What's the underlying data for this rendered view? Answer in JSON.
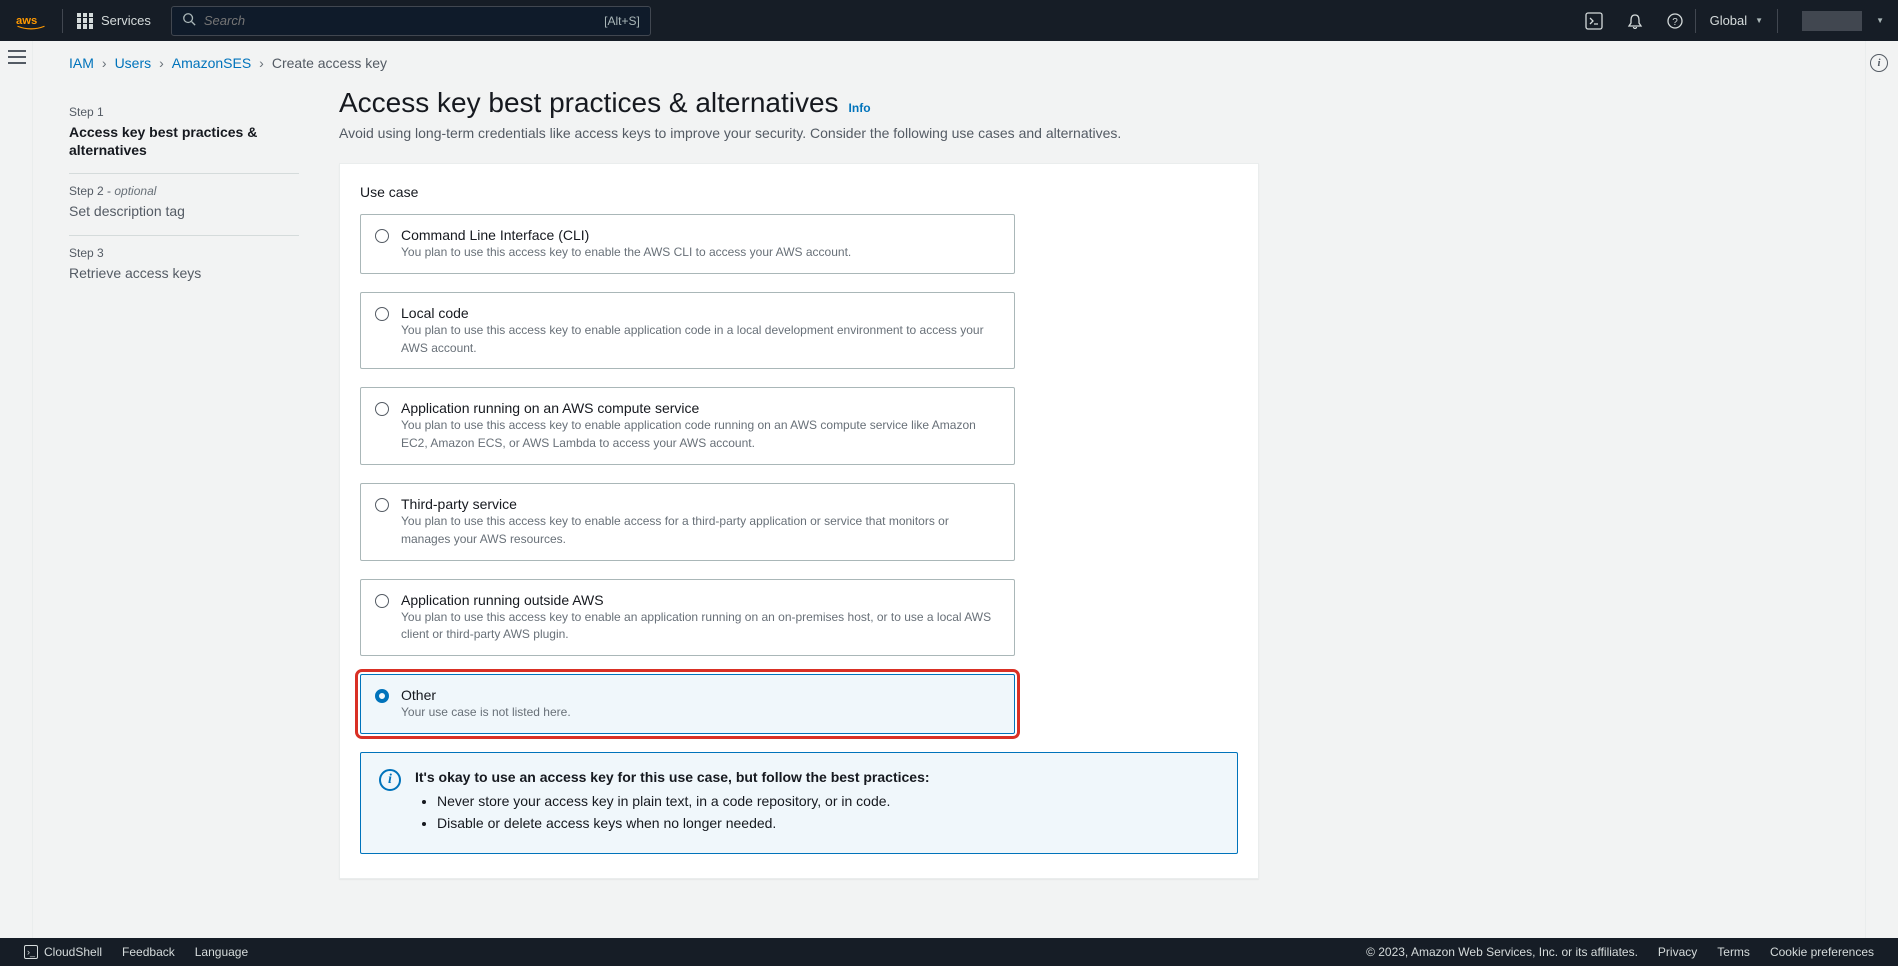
{
  "topnav": {
    "services": "Services",
    "search_placeholder": "Search",
    "search_shortcut": "[Alt+S]",
    "region": "Global"
  },
  "breadcrumbs": {
    "items": [
      "IAM",
      "Users",
      "AmazonSES"
    ],
    "current": "Create access key"
  },
  "steps": [
    {
      "num": "Step 1",
      "optional": "",
      "title": "Access key best practices & alternatives",
      "active": true
    },
    {
      "num": "Step 2",
      "optional": "optional",
      "title": "Set description tag",
      "active": false
    },
    {
      "num": "Step 3",
      "optional": "",
      "title": "Retrieve access keys",
      "active": false
    }
  ],
  "page": {
    "title": "Access key best practices & alternatives",
    "info": "Info",
    "desc": "Avoid using long-term credentials like access keys to improve your security. Consider the following use cases and alternatives."
  },
  "panel": {
    "heading": "Use case",
    "options": [
      {
        "title": "Command Line Interface (CLI)",
        "desc": "You plan to use this access key to enable the AWS CLI to access your AWS account.",
        "selected": false
      },
      {
        "title": "Local code",
        "desc": "You plan to use this access key to enable application code in a local development environment to access your AWS account.",
        "selected": false
      },
      {
        "title": "Application running on an AWS compute service",
        "desc": "You plan to use this access key to enable application code running on an AWS compute service like Amazon EC2, Amazon ECS, or AWS Lambda to access your AWS account.",
        "selected": false
      },
      {
        "title": "Third-party service",
        "desc": "You plan to use this access key to enable access for a third-party application or service that monitors or manages your AWS resources.",
        "selected": false
      },
      {
        "title": "Application running outside AWS",
        "desc": "You plan to use this access key to enable an application running on an on-premises host, or to use a local AWS client or third-party AWS plugin.",
        "selected": false
      },
      {
        "title": "Other",
        "desc": "Your use case is not listed here.",
        "selected": true
      }
    ]
  },
  "alert": {
    "title": "It's okay to use an access key for this use case, but follow the best practices:",
    "items": [
      "Never store your access key in plain text, in a code repository, or in code.",
      "Disable or delete access keys when no longer needed."
    ]
  },
  "footer": {
    "cloudshell": "CloudShell",
    "feedback": "Feedback",
    "language": "Language",
    "copyright": "© 2023, Amazon Web Services, Inc. or its affiliates.",
    "privacy": "Privacy",
    "terms": "Terms",
    "cookies": "Cookie preferences"
  }
}
